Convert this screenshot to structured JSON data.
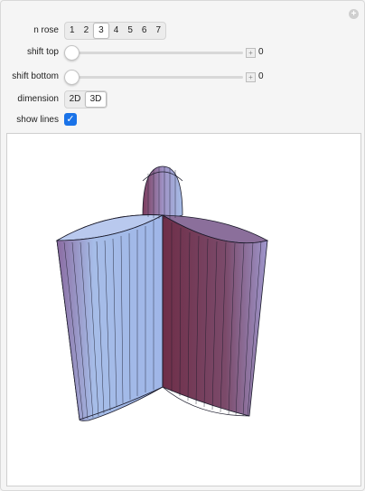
{
  "controls": {
    "n_rose": {
      "label": "n rose",
      "options": [
        "1",
        "2",
        "3",
        "4",
        "5",
        "6",
        "7"
      ],
      "selected": "3"
    },
    "shift_top": {
      "label": "shift top",
      "value": "0",
      "position": 0
    },
    "shift_bottom": {
      "label": "shift bottom",
      "value": "0",
      "position": 0
    },
    "dimension": {
      "label": "dimension",
      "options": [
        "2D",
        "3D"
      ],
      "selected": "3D"
    },
    "show_lines": {
      "label": "show lines",
      "checked": true
    }
  },
  "icons": {
    "corner": "plus-circle-icon",
    "slider_plus": "plus-square-icon",
    "checkbox": "checkmark-icon"
  },
  "colors": {
    "surface_blue": "#a3b7e6",
    "surface_red": "#7a3a55",
    "surface_purple": "#8e7bb2",
    "checkbox_blue": "#1a73e8",
    "edge_line": "#1a1a2a"
  }
}
